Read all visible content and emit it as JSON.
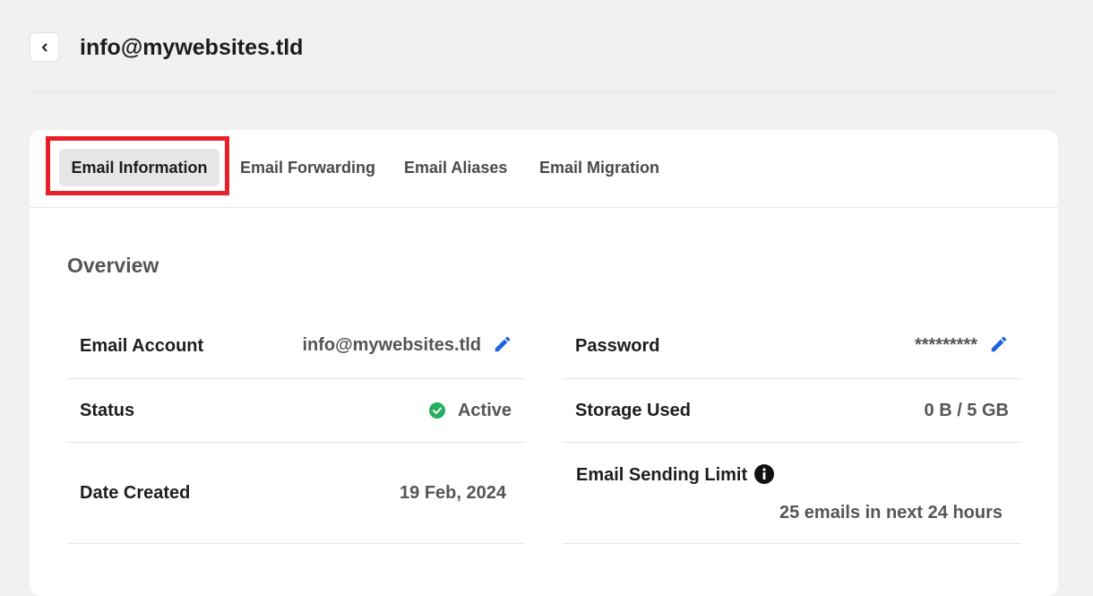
{
  "header": {
    "title": "info@mywebsites.tld",
    "back_icon": "chevron-left-icon"
  },
  "tabs": [
    {
      "label": "Email Information",
      "active": true
    },
    {
      "label": "Email Forwarding",
      "active": false
    },
    {
      "label": "Email Aliases",
      "active": false
    },
    {
      "label": "Email Migration",
      "active": false
    }
  ],
  "overview": {
    "title": "Overview",
    "email_account": {
      "label": "Email Account",
      "value": "info@mywebsites.tld",
      "icon": "pencil-icon"
    },
    "password": {
      "label": "Password",
      "value": "*********",
      "icon": "pencil-icon"
    },
    "status": {
      "label": "Status",
      "value": "Active",
      "icon": "check-circle-icon"
    },
    "storage": {
      "label": "Storage Used",
      "value": "0 B / 5 GB"
    },
    "date_created": {
      "label": "Date Created",
      "value": "19 Feb, 2024"
    },
    "sending_limit": {
      "label": "Email Sending Limit",
      "value": "25 emails in next 24 hours",
      "icon": "info-icon"
    }
  },
  "colors": {
    "accent_blue": "#1f63e0",
    "status_green": "#27ae60",
    "highlight_red": "#e8202a"
  }
}
